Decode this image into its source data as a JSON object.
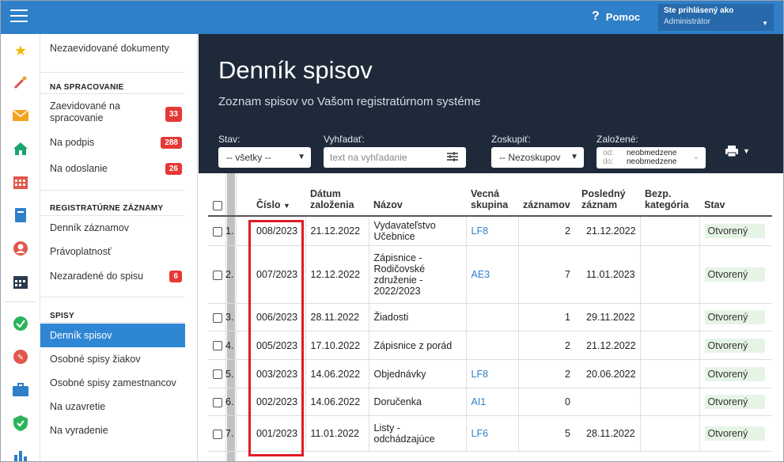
{
  "topbar": {
    "help_label": "Pomoc",
    "help_icon": "?",
    "user_label": "Ste prihlásený ako",
    "user_name": "Administrátor"
  },
  "sidebar": {
    "top_item": "Nezaevidované dokumenty",
    "section_processing": "NA SPRACOVANIE",
    "processing_items": [
      {
        "label": "Zaevidované na spracovanie",
        "count": "33"
      },
      {
        "label": "Na podpis",
        "count": "288"
      },
      {
        "label": "Na odoslanie",
        "count": "26"
      }
    ],
    "section_registry": "REGISTRATÚRNE ZÁZNAMY",
    "registry_items": [
      {
        "label": "Denník záznamov"
      },
      {
        "label": "Právoplatnosť"
      },
      {
        "label": "Nezaradené do spisu",
        "count": "6"
      }
    ],
    "section_files": "SPISY",
    "files_items": [
      {
        "label": "Denník spisov"
      },
      {
        "label": "Osobné spisy žiakov"
      },
      {
        "label": "Osobné spisy zamestnancov"
      },
      {
        "label": "Na uzavretie"
      },
      {
        "label": "Na vyradenie"
      }
    ]
  },
  "header": {
    "title": "Denník spisov",
    "subtitle": "Zoznam spisov vo Vašom registratúrnom systéme"
  },
  "filters": {
    "state_label": "Stav:",
    "state_value": "-- všetky --",
    "search_label": "Vyhľadať:",
    "search_placeholder": "text na vyhľadanie",
    "group_label": "Zoskupiť:",
    "group_value": "-- Nezoskupov",
    "created_label": "Založené:",
    "from_key": "od:",
    "from_value": "neobmedzene",
    "to_key": "do:",
    "to_value": "neobmedzene"
  },
  "table": {
    "headers": {
      "number": "Číslo",
      "created": "Dátum založenia",
      "name": "Názov",
      "group": "Vecná skupina",
      "records": "záznamov",
      "last": "Posledný záznam",
      "security": "Bezp. kategória",
      "state": "Stav"
    },
    "rows": [
      {
        "idx": "1.",
        "number": "008/2023",
        "date": "21.12.2022",
        "name": "Vydavateľstvo Učebnice",
        "group": "LF8",
        "records": "2",
        "last": "21.12.2022",
        "state": "Otvorený"
      },
      {
        "idx": "2.",
        "number": "007/2023",
        "date": "12.12.2022",
        "name": "Zápisnice - Rodičovské združenie - 2022/2023",
        "group": "AE3",
        "records": "7",
        "last": "11.01.2023",
        "state": "Otvorený"
      },
      {
        "idx": "3.",
        "number": "006/2023",
        "date": "28.11.2022",
        "name": "Žiadosti",
        "group": "",
        "records": "1",
        "last": "29.11.2022",
        "state": "Otvorený"
      },
      {
        "idx": "4.",
        "number": "005/2023",
        "date": "17.10.2022",
        "name": "Zápisnice z porád",
        "group": "",
        "records": "2",
        "last": "21.12.2022",
        "state": "Otvorený"
      },
      {
        "idx": "5.",
        "number": "003/2023",
        "date": "14.06.2022",
        "name": "Objednávky",
        "group": "LF8",
        "records": "2",
        "last": "20.06.2022",
        "state": "Otvorený"
      },
      {
        "idx": "6.",
        "number": "002/2023",
        "date": "14.06.2022",
        "name": "Doručenka",
        "group": "AI1",
        "records": "0",
        "last": "",
        "state": "Otvorený"
      },
      {
        "idx": "7.",
        "number": "001/2023",
        "date": "11.01.2022",
        "name": "Listy - odchádzajúce",
        "group": "LF6",
        "records": "5",
        "last": "28.11.2022",
        "state": "Otvorený"
      }
    ]
  },
  "colors": {
    "topbar": "#2f7fc9",
    "hero": "#1e2a3a",
    "badge": "#e53935",
    "active": "#2f86d4",
    "highlight": "#e01b24"
  }
}
